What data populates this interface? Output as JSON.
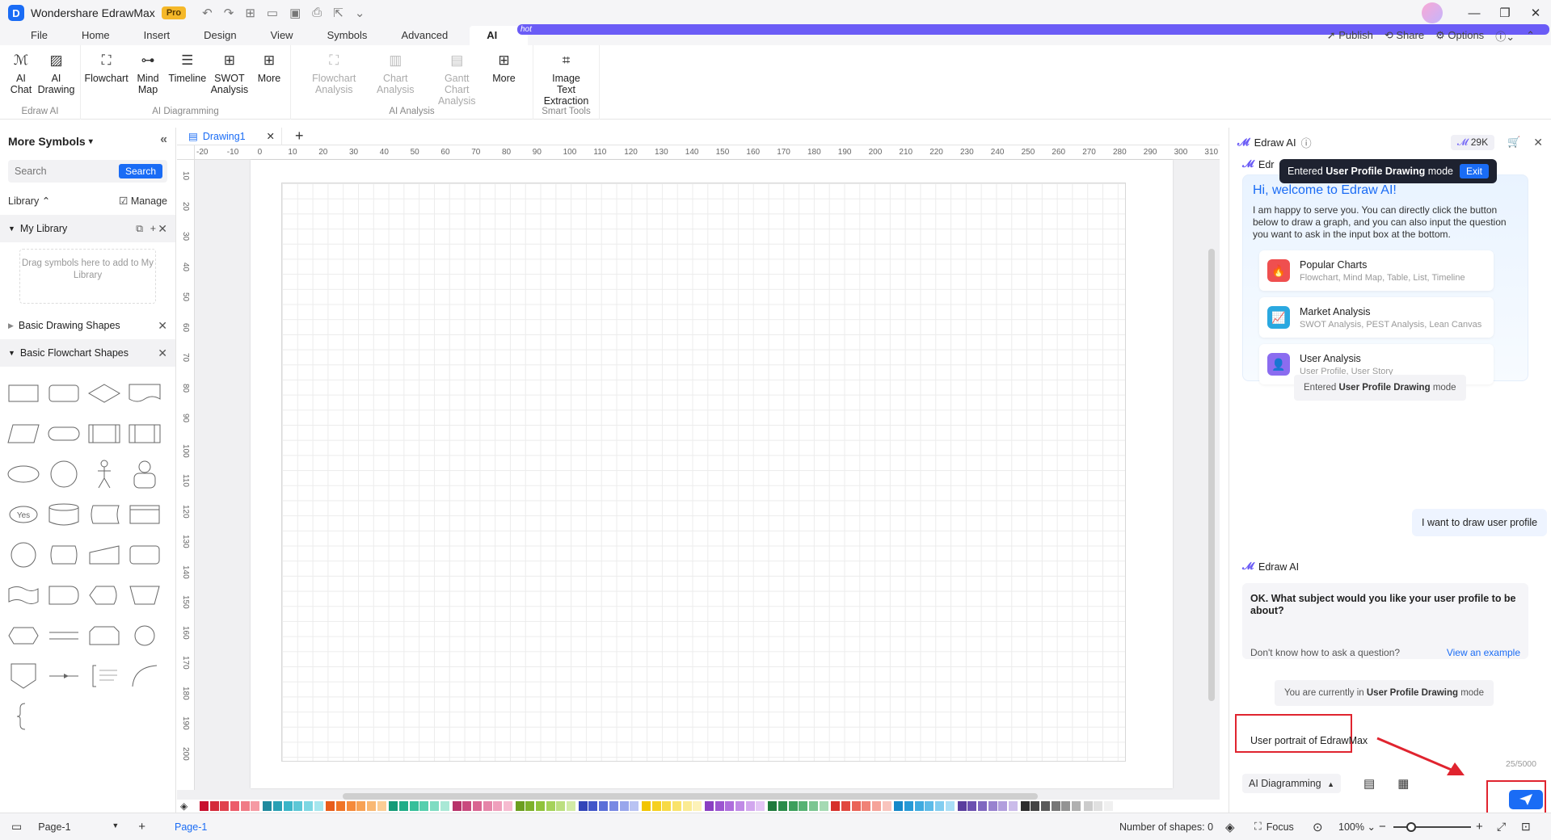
{
  "app": {
    "name": "Wondershare EdrawMax",
    "badge": "Pro"
  },
  "menu": {
    "tabs": [
      "File",
      "Home",
      "Insert",
      "Design",
      "View",
      "Symbols",
      "Advanced",
      "AI"
    ],
    "active": "AI",
    "hot_badge": "hot",
    "right": {
      "publish": "Publish",
      "share": "Share",
      "options": "Options"
    }
  },
  "ribbon": {
    "groups": [
      {
        "title": "Edraw AI",
        "buttons": [
          {
            "label": "AI Chat",
            "icon": "ai-chat-icon"
          },
          {
            "label": "AI Drawing",
            "icon": "ai-drawing-icon"
          }
        ]
      },
      {
        "title": "AI Diagramming",
        "buttons": [
          {
            "label": "Flowchart",
            "icon": "flowchart-icon"
          },
          {
            "label": "Mind Map",
            "icon": "mindmap-icon"
          },
          {
            "label": "Timeline",
            "icon": "timeline-icon"
          },
          {
            "label": "SWOT Analysis",
            "icon": "swot-icon"
          },
          {
            "label": "More",
            "icon": "more-icon"
          }
        ]
      },
      {
        "title": "AI Analysis",
        "buttons": [
          {
            "label": "Flowchart Analysis",
            "icon": "flowchart-analysis-icon",
            "disabled": true
          },
          {
            "label": "Chart Analysis",
            "icon": "chart-analysis-icon",
            "disabled": true
          },
          {
            "label": "Gantt Chart Analysis",
            "icon": "gantt-analysis-icon",
            "disabled": true
          },
          {
            "label": "More",
            "icon": "more-icon"
          }
        ]
      },
      {
        "title": "Smart Tools",
        "buttons": [
          {
            "label": "Image Text Extraction",
            "icon": "ocr-icon"
          }
        ]
      }
    ]
  },
  "leftpanel": {
    "title": "More Symbols",
    "search_placeholder": "Search",
    "search_button": "Search",
    "library_label": "Library",
    "manage_label": "Manage",
    "my_library": "My Library",
    "drop_hint": "Drag symbols here to add to My Library",
    "sections": [
      "Basic Drawing Shapes",
      "Basic Flowchart Shapes"
    ],
    "shape_labels": {
      "yes": "Yes"
    }
  },
  "canvas": {
    "tab_name": "Drawing1",
    "h_ticks": [
      "-20",
      "-10",
      "0",
      "10",
      "20",
      "30",
      "40",
      "50",
      "60",
      "70",
      "80",
      "90",
      "100",
      "110",
      "120",
      "130",
      "140",
      "150",
      "160",
      "170",
      "180",
      "190",
      "200",
      "210",
      "220",
      "230",
      "240",
      "250",
      "260",
      "270",
      "280",
      "290",
      "300",
      "310"
    ],
    "v_ticks": [
      "10",
      "20",
      "30",
      "40",
      "50",
      "60",
      "70",
      "80",
      "90",
      "100",
      "110",
      "120",
      "130",
      "140",
      "150",
      "160",
      "170",
      "180",
      "190",
      "200"
    ]
  },
  "colors": [
    "#c8102e",
    "#d42a3a",
    "#e0424e",
    "#ec5c6a",
    "#f07b86",
    "#f59aa3",
    "#1f8a9e",
    "#2aa0b4",
    "#3bb5c8",
    "#5cc7d6",
    "#7dd7e3",
    "#a5e6ee",
    "#e85d1a",
    "#f07425",
    "#f58a3a",
    "#f7a255",
    "#f9b873",
    "#fbcd95",
    "#139a77",
    "#20ad88",
    "#36bf9a",
    "#57cfae",
    "#7fdcc2",
    "#a9e8d6",
    "#b8336a",
    "#c94a7e",
    "#d96592",
    "#e585a9",
    "#ef9fbc",
    "#f6bbd0",
    "#6b9e1f",
    "#7db12a",
    "#90c33c",
    "#a5d25a",
    "#bcdf80",
    "#d2eba6",
    "#3245b8",
    "#4257c9",
    "#5a6fd8",
    "#7889e3",
    "#98a6ec",
    "#b9c3f3",
    "#f2c500",
    "#f5d020",
    "#f7da45",
    "#f9e36c",
    "#fbeb93",
    "#fdf2b8",
    "#8a3fc2",
    "#9c55d0",
    "#ae6ddc",
    "#c08ae6",
    "#d2a7ee",
    "#e3c5f5",
    "#1e7a3c",
    "#2a8c4a",
    "#3c9f5c",
    "#57b274",
    "#7cc692",
    "#a5dab3",
    "#d6312b",
    "#e1483f",
    "#ea6357",
    "#f08276",
    "#f5a399",
    "#f9c4bd",
    "#1588c9",
    "#2699d6",
    "#3eaae0",
    "#5dbbe8",
    "#82cdf0",
    "#a9def6",
    "#5a3e9e",
    "#6c51b0",
    "#8068c0",
    "#9882cf",
    "#b19edd",
    "#cbbcea",
    "#2d2d2d",
    "#444444",
    "#5c5c5c",
    "#777777",
    "#939393",
    "#b0b0b0",
    "#cccccc",
    "#e0e0e0",
    "#f0f0f0"
  ],
  "statusbar": {
    "page_selector": "Page-1",
    "page_tab": "Page-1",
    "shapes_count": "Number of shapes: 0",
    "focus": "Focus",
    "zoom": "100%"
  },
  "ai": {
    "title": "Edraw AI",
    "credits": "29K",
    "toast": {
      "prefix": "Entered",
      "mode": "User Profile Drawing",
      "suffix": "mode",
      "exit": "Exit"
    },
    "welcome_title": "Hi, welcome to Edraw AI!",
    "welcome_text": "I am happy to serve you. You can directly click the button below to draw a graph, and you can also input the question you want to ask in the input box at the bottom.",
    "cards": [
      {
        "title": "Popular Charts",
        "sub": "Flowchart, Mind Map, Table, List, Timeline",
        "color": "#ef4f4f",
        "icon": "fire-icon"
      },
      {
        "title": "Market Analysis",
        "sub": "SWOT Analysis, PEST Analysis, Lean Canvas",
        "color": "#2aa8e0",
        "icon": "chart-icon"
      },
      {
        "title": "User Analysis",
        "sub": "User Profile, User Story",
        "color": "#8b6cf0",
        "icon": "user-icon"
      }
    ],
    "mode_pill": {
      "prefix": "Entered",
      "mode": "User Profile Drawing",
      "suffix": "mode"
    },
    "user_msg": "I want to draw user profile",
    "bot_name": "Edraw AI",
    "bot_question": "OK. What subject would you like your user profile to be about?",
    "bot_hint": "Don't know how to ask a question?",
    "bot_example": "View an example",
    "current_pill": {
      "prefix": "You are currently in",
      "mode": "User Profile Drawing",
      "suffix": "mode"
    },
    "input_value": "User portrait of EdrawMax",
    "counter": "25/5000",
    "dropdown": "AI Diagramming"
  }
}
